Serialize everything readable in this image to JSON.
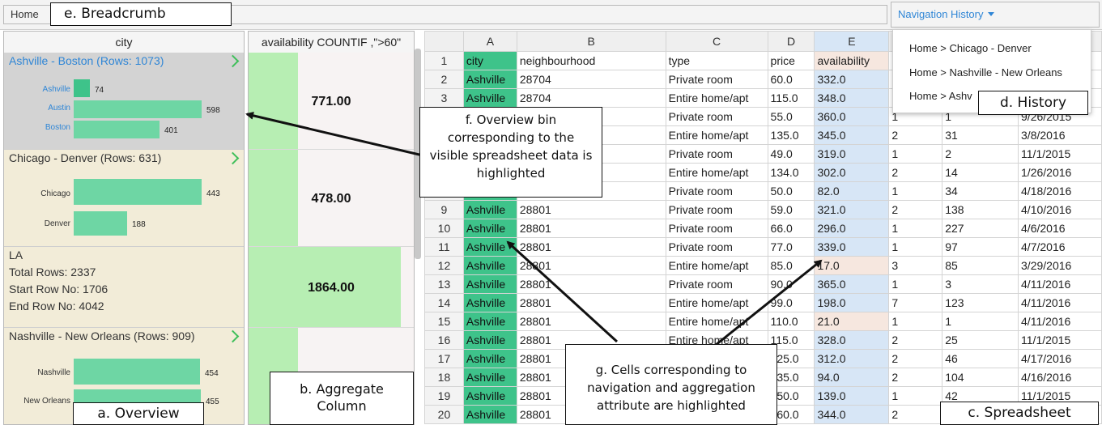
{
  "breadcrumb": {
    "home": "Home"
  },
  "nav_history": {
    "label": "Navigation History",
    "items": [
      "Home > Chicago - Denver",
      "Home > Nashville - New Orleans",
      "Home > Ashv"
    ]
  },
  "overview": {
    "header": "city",
    "bins": [
      {
        "title": "Ashville - Boston (Rows: 1073)",
        "bars": [
          {
            "label": "Ashville",
            "value": "74"
          },
          {
            "label": "Austin",
            "value": "598"
          },
          {
            "label": "Boston",
            "value": "401"
          }
        ]
      },
      {
        "title": "Chicago - Denver (Rows: 631)",
        "bars": [
          {
            "label": "Chicago",
            "value": "443"
          },
          {
            "label": "Denver",
            "value": "188"
          }
        ]
      },
      {
        "info": [
          "LA",
          "Total Rows: 2337",
          "Start Row No: 1706",
          "End Row No: 4042"
        ]
      },
      {
        "title": "Nashville - New Orleans (Rows: 909)",
        "bars": [
          {
            "label": "Nashville",
            "value": "454"
          },
          {
            "label": "New Orleans",
            "value": "455"
          }
        ]
      }
    ]
  },
  "aggregate": {
    "header": "availability COUNTIF ,\">60\"",
    "cells": [
      {
        "value": "771.00",
        "fill": 0.3
      },
      {
        "value": "478.00",
        "fill": 0.3
      },
      {
        "value": "1864.00",
        "fill": 0.92
      },
      {
        "value": "",
        "fill": 0.3
      }
    ]
  },
  "sheet": {
    "columns": [
      "A",
      "B",
      "C",
      "D",
      "E",
      "",
      "",
      ""
    ],
    "header_row": [
      "1",
      "city",
      "neighbourhood",
      "type",
      "price",
      "availability",
      "",
      "",
      ""
    ],
    "rows": [
      [
        "2",
        "Ashville",
        "28704",
        "Private room",
        "60.0",
        "332.0",
        "",
        "",
        ""
      ],
      [
        "3",
        "Ashville",
        "28704",
        "Entire home/apt",
        "115.0",
        "348.0",
        "",
        "",
        ""
      ],
      [
        "4",
        "",
        "",
        "Private room",
        "55.0",
        "360.0",
        "1",
        "1",
        "9/26/2015"
      ],
      [
        "5",
        "",
        "",
        "Entire home/apt",
        "135.0",
        "345.0",
        "2",
        "31",
        "3/8/2016"
      ],
      [
        "6",
        "",
        "",
        "Private room",
        "49.0",
        "319.0",
        "1",
        "2",
        "11/1/2015"
      ],
      [
        "7",
        "",
        "",
        "Entire home/apt",
        "134.0",
        "302.0",
        "2",
        "14",
        "1/26/2016"
      ],
      [
        "8",
        "",
        "",
        "Private room",
        "50.0",
        "82.0",
        "1",
        "34",
        "4/18/2016"
      ],
      [
        "9",
        "Ashville",
        "28801",
        "Private room",
        "59.0",
        "321.0",
        "2",
        "138",
        "4/10/2016"
      ],
      [
        "10",
        "Ashville",
        "28801",
        "Private room",
        "66.0",
        "296.0",
        "1",
        "227",
        "4/6/2016"
      ],
      [
        "11",
        "Ashville",
        "28801",
        "Private room",
        "77.0",
        "339.0",
        "1",
        "97",
        "4/7/2016"
      ],
      [
        "12",
        "Ashville",
        "28801",
        "Entire home/apt",
        "85.0",
        "17.0",
        "3",
        "85",
        "3/29/2016"
      ],
      [
        "13",
        "Ashville",
        "28801",
        "Private room",
        "90.0",
        "365.0",
        "1",
        "3",
        "4/11/2016"
      ],
      [
        "14",
        "Ashville",
        "28801",
        "Entire home/apt",
        "99.0",
        "198.0",
        "7",
        "123",
        "4/11/2016"
      ],
      [
        "15",
        "Ashville",
        "28801",
        "Entire home/apt",
        "110.0",
        "21.0",
        "1",
        "1",
        "4/11/2016"
      ],
      [
        "16",
        "Ashville",
        "28801",
        "Entire home/apt",
        "115.0",
        "328.0",
        "2",
        "25",
        "11/1/2015"
      ],
      [
        "17",
        "Ashville",
        "28801",
        "",
        "125.0",
        "312.0",
        "2",
        "46",
        "4/17/2016"
      ],
      [
        "18",
        "Ashville",
        "28801",
        "",
        "135.0",
        "94.0",
        "2",
        "104",
        "4/16/2016"
      ],
      [
        "19",
        "Ashville",
        "28801",
        "",
        "150.0",
        "139.0",
        "1",
        "42",
        "11/1/2015"
      ],
      [
        "20",
        "Ashville",
        "28801",
        "",
        "160.0",
        "344.0",
        "2",
        "",
        ""
      ]
    ]
  },
  "annotations": {
    "breadcrumb": "e. Breadcrumb",
    "history": "d. History",
    "overview": "a. Overview",
    "aggregate": "b. Aggregate Column",
    "spreadsheet": "c. Spreadsheet",
    "bin_highlight": "f. Overview bin corresponding to the visible spreadsheet data is highlighted",
    "cells_highlight": "g. Cells corresponding to navigation and aggregation attribute are highlighted"
  }
}
